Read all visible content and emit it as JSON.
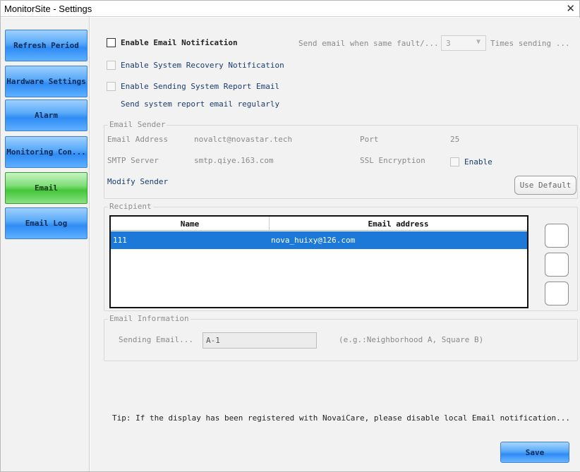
{
  "window": {
    "title": "MonitorSite - Settings",
    "close_symbol": "✕"
  },
  "sidebar": {
    "items": [
      {
        "label": "Refresh Period",
        "active": false
      },
      {
        "label": "Hardware Settings",
        "active": false
      },
      {
        "label": "Alarm",
        "active": false
      },
      {
        "label": "Monitoring Con...",
        "active": false
      },
      {
        "label": "Email",
        "active": true
      },
      {
        "label": "Email Log",
        "active": false
      }
    ]
  },
  "email_settings": {
    "enable_email_notification": {
      "label": "Enable Email Notification",
      "checked": false
    },
    "send_when_same_fault_label": "Send email when same fault/...",
    "times_value": "3",
    "times_suffix": "Times sending ...",
    "enable_system_recovery_notification": {
      "label": "Enable System Recovery Notification",
      "checked": false
    },
    "enable_sending_system_report": {
      "label": "Enable Sending System Report Email",
      "checked": false
    },
    "report_regularly_label": "Send system report email regularly"
  },
  "email_sender": {
    "legend": "Email Sender",
    "email_address_label": "Email Address",
    "email_address_value": "novalct@novastar.tech",
    "port_label": "Port",
    "port_value": "25",
    "smtp_server_label": "SMTP Server",
    "smtp_server_value": "smtp.qiye.163.com",
    "ssl_label": "SSL Encryption",
    "ssl_enable_label": "Enable",
    "modify_sender_label": "Modify Sender",
    "use_default_label": "Use Default"
  },
  "recipient": {
    "legend": "Recipient",
    "columns": [
      "Name",
      "Email address"
    ],
    "rows": [
      {
        "name": "111",
        "email": "nova_huixy@126.com",
        "selected": true
      }
    ]
  },
  "email_information": {
    "legend": "Email Information",
    "sending_email_label": "Sending Email...",
    "sending_email_value": "A-1",
    "example_hint": "(e.g.:Neighborhood A, Square B)"
  },
  "tip": "Tip: If the display has been registered with NovaiCare, please disable local Email notification...",
  "save_label": "Save",
  "colors": {
    "nav_blue": "#2f8cf4",
    "nav_active_green": "#45c53a",
    "selection_blue": "#1c79d8"
  }
}
